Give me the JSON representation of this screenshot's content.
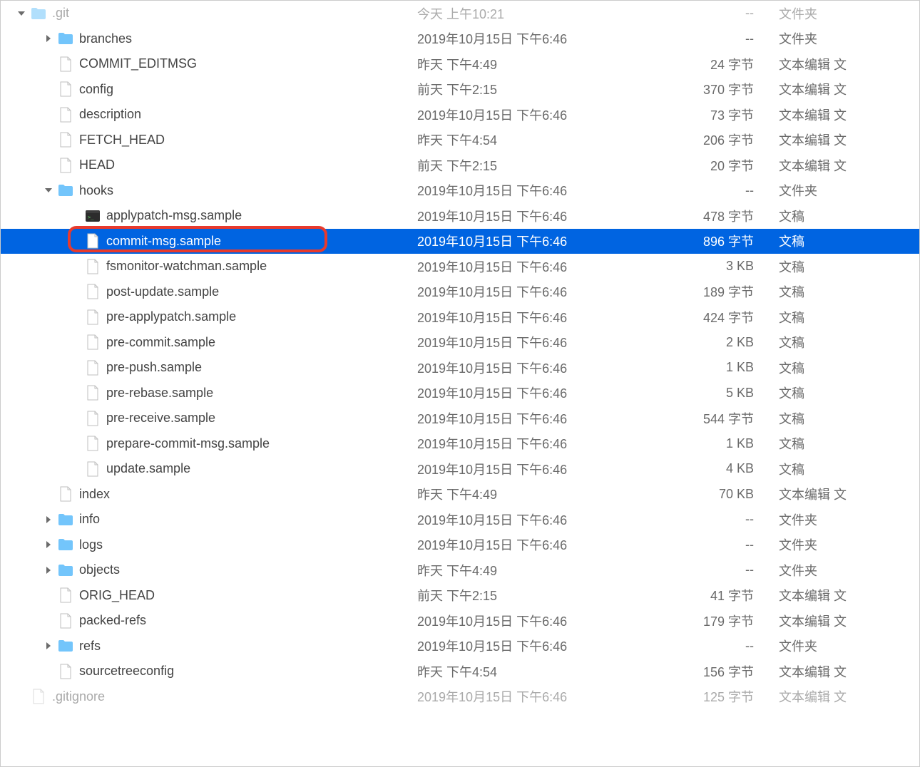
{
  "rows": [
    {
      "indent": 0,
      "chev": "down",
      "icon": "folder",
      "dim": true,
      "name": ".git",
      "modified": "今天 上午10:21",
      "size": "--",
      "kind": "文件夹"
    },
    {
      "indent": 1,
      "chev": "right",
      "icon": "folder",
      "name": "branches",
      "modified": "2019年10月15日 下午6:46",
      "size": "--",
      "kind": "文件夹"
    },
    {
      "indent": 1,
      "chev": "",
      "icon": "file",
      "name": "COMMIT_EDITMSG",
      "modified": "昨天 下午4:49",
      "size": "24 字节",
      "kind": "文本编辑 文"
    },
    {
      "indent": 1,
      "chev": "",
      "icon": "file",
      "name": "config",
      "modified": "前天 下午2:15",
      "size": "370 字节",
      "kind": "文本编辑 文"
    },
    {
      "indent": 1,
      "chev": "",
      "icon": "file",
      "name": "description",
      "modified": "2019年10月15日 下午6:46",
      "size": "73 字节",
      "kind": "文本编辑 文"
    },
    {
      "indent": 1,
      "chev": "",
      "icon": "file",
      "name": "FETCH_HEAD",
      "modified": "昨天 下午4:54",
      "size": "206 字节",
      "kind": "文本编辑 文"
    },
    {
      "indent": 1,
      "chev": "",
      "icon": "file",
      "name": "HEAD",
      "modified": "前天 下午2:15",
      "size": "20 字节",
      "kind": "文本编辑 文"
    },
    {
      "indent": 1,
      "chev": "down",
      "icon": "folder",
      "name": "hooks",
      "modified": "2019年10月15日 下午6:46",
      "size": "--",
      "kind": "文件夹"
    },
    {
      "indent": 2,
      "chev": "",
      "icon": "exec",
      "name": "applypatch-msg.sample",
      "modified": "2019年10月15日 下午6:46",
      "size": "478 字节",
      "kind": "文稿"
    },
    {
      "indent": 2,
      "chev": "",
      "icon": "file",
      "name": "commit-msg.sample",
      "modified": "2019年10月15日 下午6:46",
      "size": "896 字节",
      "kind": "文稿",
      "selected": true,
      "highlight": true
    },
    {
      "indent": 2,
      "chev": "",
      "icon": "file",
      "name": "fsmonitor-watchman.sample",
      "modified": "2019年10月15日 下午6:46",
      "size": "3 KB",
      "kind": "文稿"
    },
    {
      "indent": 2,
      "chev": "",
      "icon": "file",
      "name": "post-update.sample",
      "modified": "2019年10月15日 下午6:46",
      "size": "189 字节",
      "kind": "文稿"
    },
    {
      "indent": 2,
      "chev": "",
      "icon": "file",
      "name": "pre-applypatch.sample",
      "modified": "2019年10月15日 下午6:46",
      "size": "424 字节",
      "kind": "文稿"
    },
    {
      "indent": 2,
      "chev": "",
      "icon": "file",
      "name": "pre-commit.sample",
      "modified": "2019年10月15日 下午6:46",
      "size": "2 KB",
      "kind": "文稿"
    },
    {
      "indent": 2,
      "chev": "",
      "icon": "file",
      "name": "pre-push.sample",
      "modified": "2019年10月15日 下午6:46",
      "size": "1 KB",
      "kind": "文稿"
    },
    {
      "indent": 2,
      "chev": "",
      "icon": "file",
      "name": "pre-rebase.sample",
      "modified": "2019年10月15日 下午6:46",
      "size": "5 KB",
      "kind": "文稿"
    },
    {
      "indent": 2,
      "chev": "",
      "icon": "file",
      "name": "pre-receive.sample",
      "modified": "2019年10月15日 下午6:46",
      "size": "544 字节",
      "kind": "文稿"
    },
    {
      "indent": 2,
      "chev": "",
      "icon": "file",
      "name": "prepare-commit-msg.sample",
      "modified": "2019年10月15日 下午6:46",
      "size": "1 KB",
      "kind": "文稿"
    },
    {
      "indent": 2,
      "chev": "",
      "icon": "file",
      "name": "update.sample",
      "modified": "2019年10月15日 下午6:46",
      "size": "4 KB",
      "kind": "文稿"
    },
    {
      "indent": 1,
      "chev": "",
      "icon": "file",
      "name": "index",
      "modified": "昨天 下午4:49",
      "size": "70 KB",
      "kind": "文本编辑 文"
    },
    {
      "indent": 1,
      "chev": "right",
      "icon": "folder",
      "name": "info",
      "modified": "2019年10月15日 下午6:46",
      "size": "--",
      "kind": "文件夹"
    },
    {
      "indent": 1,
      "chev": "right",
      "icon": "folder",
      "name": "logs",
      "modified": "2019年10月15日 下午6:46",
      "size": "--",
      "kind": "文件夹"
    },
    {
      "indent": 1,
      "chev": "right",
      "icon": "folder",
      "name": "objects",
      "modified": "昨天 下午4:49",
      "size": "--",
      "kind": "文件夹"
    },
    {
      "indent": 1,
      "chev": "",
      "icon": "file",
      "name": "ORIG_HEAD",
      "modified": "前天 下午2:15",
      "size": "41 字节",
      "kind": "文本编辑 文"
    },
    {
      "indent": 1,
      "chev": "",
      "icon": "file",
      "name": "packed-refs",
      "modified": "2019年10月15日 下午6:46",
      "size": "179 字节",
      "kind": "文本编辑 文"
    },
    {
      "indent": 1,
      "chev": "right",
      "icon": "folder",
      "name": "refs",
      "modified": "2019年10月15日 下午6:46",
      "size": "--",
      "kind": "文件夹"
    },
    {
      "indent": 1,
      "chev": "",
      "icon": "file",
      "name": "sourcetreeconfig",
      "modified": "昨天 下午4:54",
      "size": "156 字节",
      "kind": "文本编辑 文"
    },
    {
      "indent": 0,
      "chev": "",
      "icon": "file",
      "dim": true,
      "name": ".gitignore",
      "modified": "2019年10月15日 下午6:46",
      "size": "125 字节",
      "kind": "文本编辑 文"
    }
  ]
}
